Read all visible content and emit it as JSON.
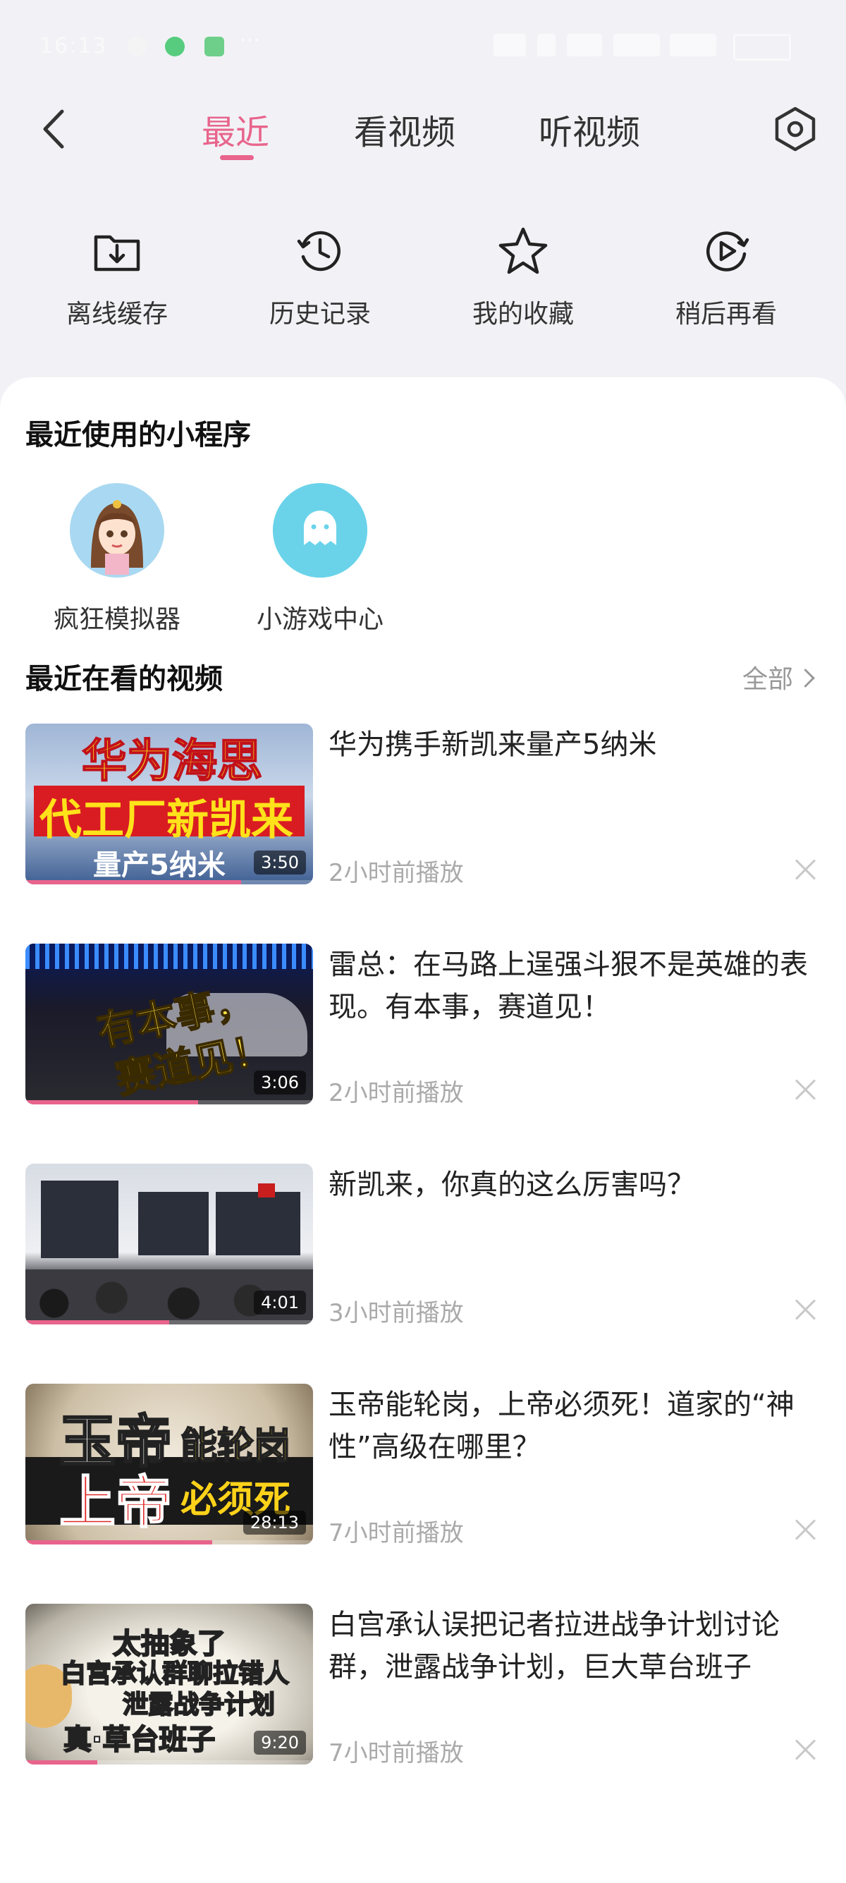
{
  "status_bar": {
    "time": "16:13",
    "icons": [
      "app-icon",
      "phone-icon",
      "message-icon"
    ],
    "more": "···",
    "right_icons": [
      "bluetooth-icon",
      "hd-icon",
      "signal-icon",
      "signal-icon",
      "battery-icon"
    ]
  },
  "nav": {
    "tabs": [
      {
        "label": "最近",
        "active": true
      },
      {
        "label": "看视频",
        "active": false
      },
      {
        "label": "听视频",
        "active": false
      }
    ],
    "accent": "#e8648c"
  },
  "quick_actions": [
    {
      "label": "离线缓存",
      "icon": "download-folder-icon"
    },
    {
      "label": "历史记录",
      "icon": "history-clock-icon"
    },
    {
      "label": "我的收藏",
      "icon": "star-icon"
    },
    {
      "label": "稍后再看",
      "icon": "watch-later-icon"
    }
  ],
  "mini_programs": {
    "title": "最近使用的小程序",
    "items": [
      {
        "label": "疯狂模拟器",
        "icon": "avatar-girl-icon"
      },
      {
        "label": "小游戏中心",
        "icon": "ghost-icon"
      }
    ]
  },
  "recent_videos": {
    "title": "最近在看的视频",
    "all_link": "全部",
    "items": [
      {
        "title": "华为携手新凯来量产5纳米",
        "time": "2小时前播放",
        "duration": "3:50",
        "progress": 0.75,
        "thumb_text": [
          "华为海思",
          "代工厂新凯来",
          "量产5纳米"
        ]
      },
      {
        "title": "雷总：在马路上逞强斗狠不是英雄的表现。有本事，赛道见！",
        "time": "2小时前播放",
        "duration": "3:06",
        "progress": 0.6,
        "thumb_text": [
          "有本事，",
          "赛道见！"
        ]
      },
      {
        "title": "新凯来，你真的这么厉害吗？",
        "time": "3小时前播放",
        "duration": "4:01",
        "progress": 0.5,
        "thumb_text": []
      },
      {
        "title": "玉帝能轮岗，上帝必须死！道家的“神性”高级在哪里？",
        "time": "7小时前播放",
        "duration": "28:13",
        "progress": 0.65,
        "thumb_text": [
          "玉帝",
          "能轮岗",
          "上帝",
          "必须死"
        ]
      },
      {
        "title": "白宫承认误把记者拉进战争计划讨论群，泄露战争计划，巨大草台班子",
        "time": "7小时前播放",
        "duration": "9:20",
        "progress": 0.25,
        "thumb_text": [
          "太抽象了",
          "白宫承认群聊拉错人",
          "泄露战争计划",
          "真·草台班子"
        ]
      }
    ]
  }
}
